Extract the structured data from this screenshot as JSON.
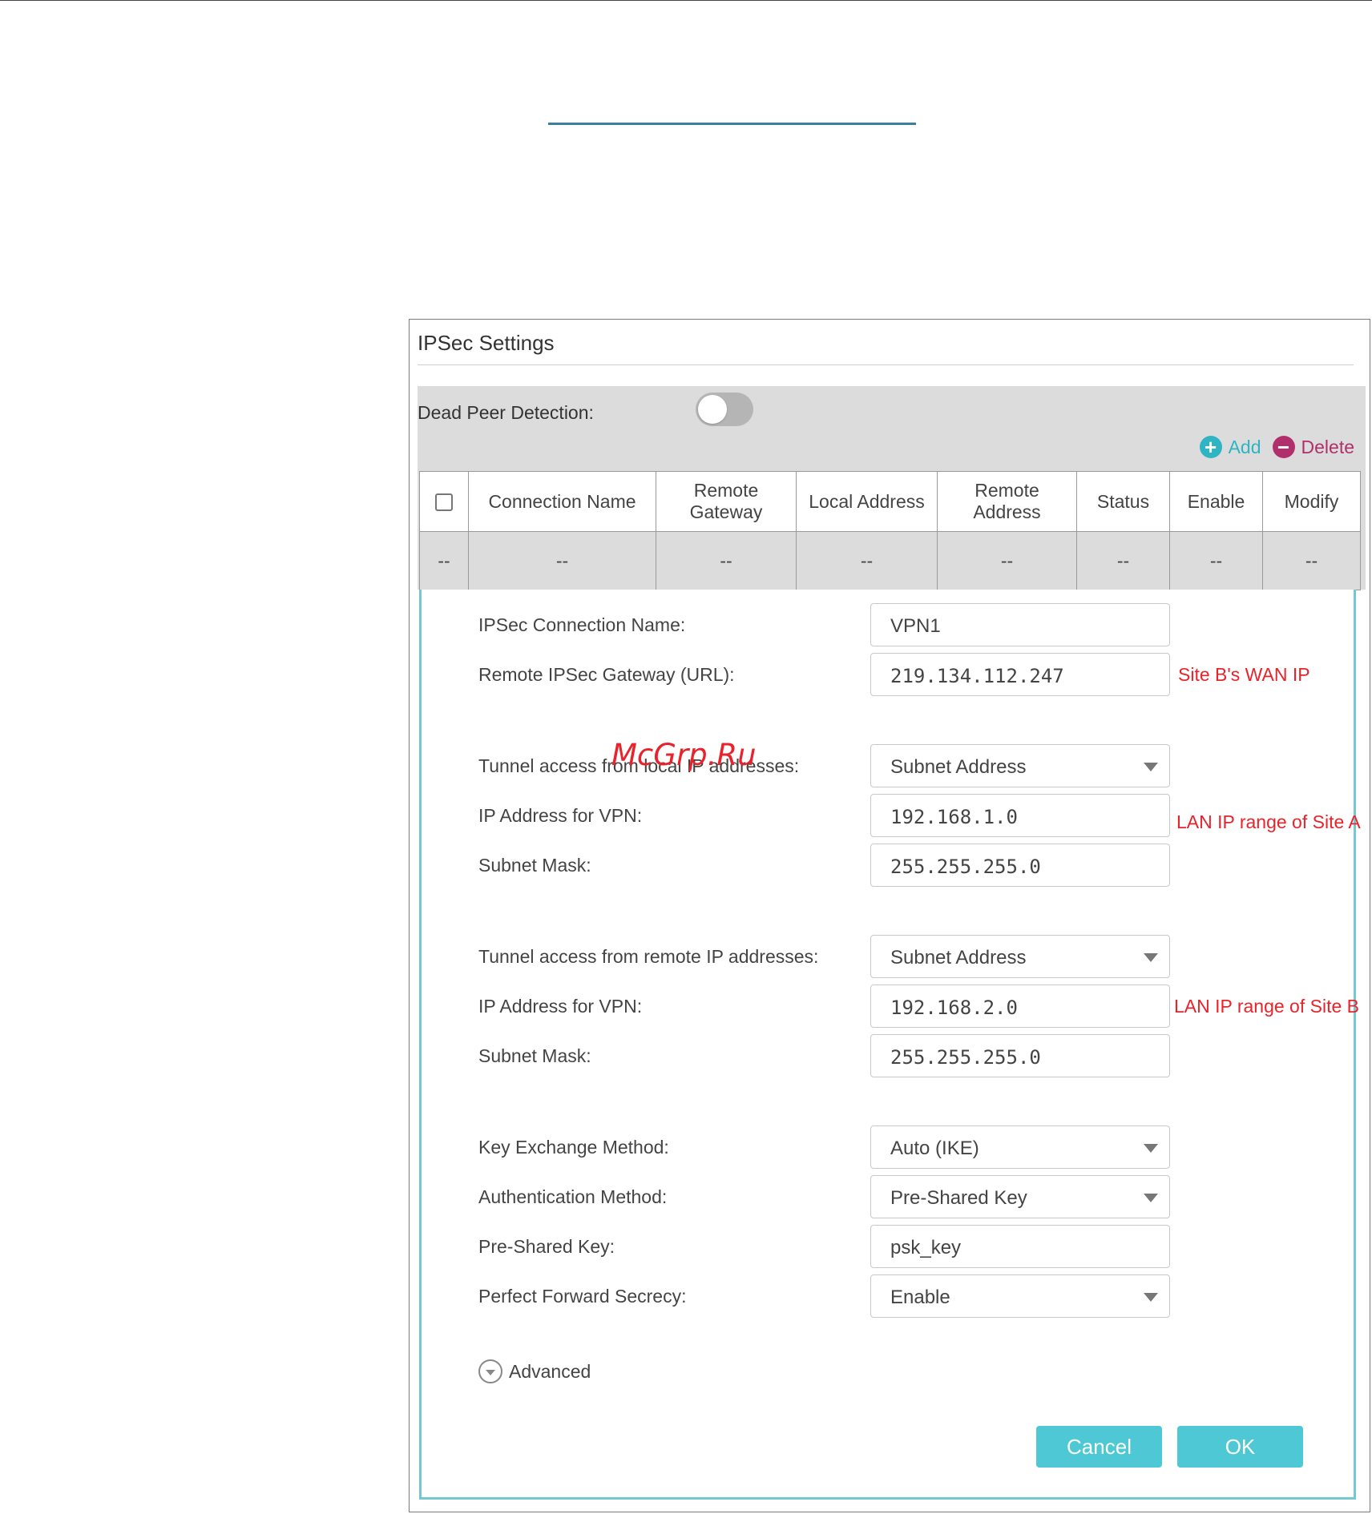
{
  "panel": {
    "title": "IPSec Settings"
  },
  "dead_peer_detection": {
    "label": "Dead Peer Detection:",
    "enabled": false
  },
  "actions": {
    "add_label": "Add",
    "delete_label": "Delete"
  },
  "table": {
    "headers": [
      {
        "line1": "Connection Name",
        "line2": ""
      },
      {
        "line1": "Remote",
        "line2": "Gateway"
      },
      {
        "line1": "Local Address",
        "line2": ""
      },
      {
        "line1": "Remote",
        "line2": "Address"
      },
      {
        "line1": "Status",
        "line2": ""
      },
      {
        "line1": "Enable",
        "line2": ""
      },
      {
        "line1": "Modify",
        "line2": ""
      }
    ],
    "row": [
      "--",
      "--",
      "--",
      "--",
      "--",
      "--",
      "--",
      "--"
    ]
  },
  "form": {
    "connection_name": {
      "label": "IPSec Connection Name:",
      "value": "VPN1"
    },
    "remote_gateway": {
      "label": "Remote IPSec Gateway (URL):",
      "value": "219.134.112.247",
      "note": "Site B's WAN IP"
    },
    "local_access": {
      "label": "Tunnel access from local IP addresses:",
      "value": "Subnet Address"
    },
    "local_ip": {
      "label": "IP Address for VPN:",
      "value": "192.168.1.0",
      "note": "LAN IP range of Site A"
    },
    "local_mask": {
      "label": "Subnet Mask:",
      "value": "255.255.255.0"
    },
    "remote_access": {
      "label": "Tunnel access from remote IP addresses:",
      "value": "Subnet Address"
    },
    "remote_ip": {
      "label": "IP Address for VPN:",
      "value": "192.168.2.0",
      "note": "LAN IP range of Site B"
    },
    "remote_mask": {
      "label": "Subnet Mask:",
      "value": "255.255.255.0"
    },
    "key_exchange": {
      "label": "Key Exchange Method:",
      "value": "Auto (IKE)"
    },
    "auth_method": {
      "label": "Authentication Method:",
      "value": "Pre-Shared Key"
    },
    "psk": {
      "label": "Pre-Shared Key:",
      "value": "psk_key"
    },
    "pfs": {
      "label": "Perfect Forward Secrecy:",
      "value": "Enable"
    },
    "advanced_label": "Advanced"
  },
  "buttons": {
    "cancel": "Cancel",
    "ok": "OK"
  },
  "watermark": "McGrp.Ru",
  "colors": {
    "accent": "#4ec8d4",
    "panel_border": "#74c8cf",
    "add": "#2fb4c4",
    "delete": "#b0306b",
    "note": "#e8232b"
  }
}
